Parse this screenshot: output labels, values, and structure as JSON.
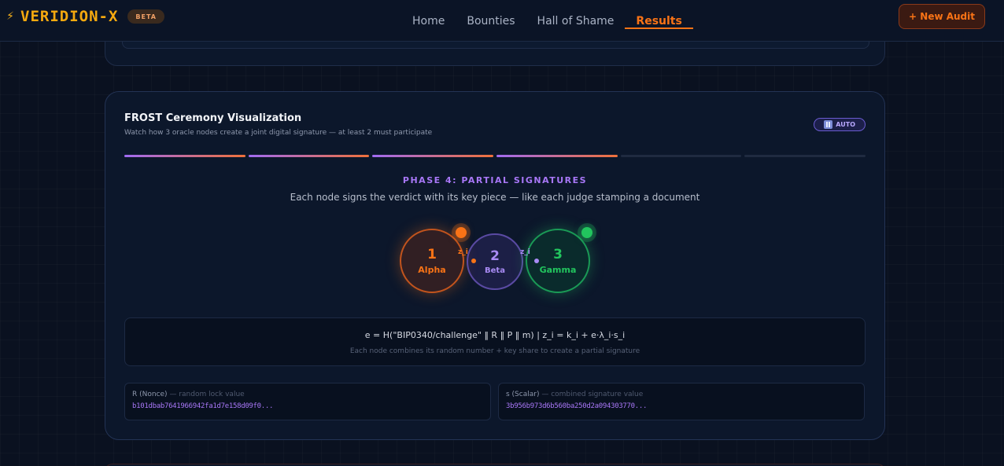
{
  "header": {
    "brand_icon": "lightning-bolt-icon",
    "brand_name": "VERIDION-X",
    "beta_label": "BETA",
    "nav": [
      "Home",
      "Bounties",
      "Hall of Shame",
      "Results"
    ],
    "active_nav": "Results",
    "new_audit_label": "+ New Audit"
  },
  "ceremony": {
    "title": "FROST Ceremony Visualization",
    "subtitle": "Watch how 3 oracle nodes create a joint digital signature — at least 2 must participate",
    "auto_label": "AUTO",
    "phase_count": 6,
    "phase_current": 4,
    "phase_title": "PHASE 4: PARTIAL SIGNATURES",
    "phase_description": "Each node signs the verdict with its key piece — like each judge stamping a document",
    "nodes": [
      {
        "number": "1",
        "name": "Alpha",
        "color": "#f97316",
        "signed": true
      },
      {
        "number": "2",
        "name": "Beta",
        "color": "#a98bf5",
        "signed": false
      },
      {
        "number": "3",
        "name": "Gamma",
        "color": "#22c55e",
        "signed": true
      }
    ],
    "partial_label": "z_i",
    "formula": "e = H(\"BIP0340/challenge\" ‖ R ‖ P ‖ m) | z_i = k_i + e·λ_i·s_i",
    "formula_note": "Each node combines its random number + key share to create a partial signature",
    "nonce": {
      "key": "R (Nonce)",
      "hint": "— random lock value",
      "value": "b101dbab7641966942fa1d7e158d09f0..."
    },
    "scalar": {
      "key": "s (Scalar)",
      "hint": "— combined signature value",
      "value": "3b956b973d6b560ba250d2a094303770..."
    }
  },
  "colors": {
    "accent": "#f97316",
    "purple": "#a877f7",
    "green": "#22c55e",
    "brand": "#f5a90f"
  }
}
